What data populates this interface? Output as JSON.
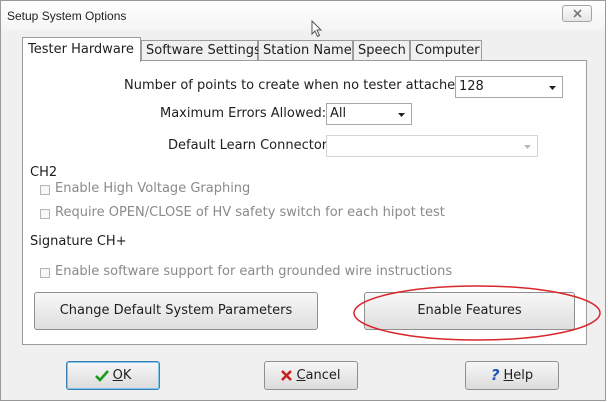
{
  "window": {
    "title": "Setup System Options"
  },
  "tabs": [
    {
      "label": "Tester Hardware",
      "active": true
    },
    {
      "label": "Software Settings",
      "active": false
    },
    {
      "label": "Station Name",
      "active": false
    },
    {
      "label": "Speech",
      "active": false
    },
    {
      "label": "Computer",
      "active": false
    }
  ],
  "tester_hardware": {
    "points_label": "Number of points to create when no tester attached:",
    "points_value": "128",
    "max_errors_label": "Maximum Errors Allowed:",
    "max_errors_value": "All",
    "learn_connector_label": "Default Learn Connector:",
    "learn_connector_value": "",
    "ch2_heading": "CH2",
    "hv_graphing_label": "Enable High Voltage Graphing",
    "hv_switch_label": "Require OPEN/CLOSE of HV safety switch for each hipot test",
    "signature_heading": "Signature CH+",
    "earth_ground_label": "Enable software support for earth grounded wire instructions",
    "change_defaults_button": "Change Default System Parameters",
    "enable_features_button": "Enable Features"
  },
  "footer": {
    "ok": {
      "accel": "O",
      "rest": "K"
    },
    "cancel": {
      "accel": "C",
      "rest": "ancel"
    },
    "help": {
      "accel": "H",
      "rest": "elp"
    }
  },
  "colors": {
    "highlight_ellipse": "#d9262b",
    "ok_check": "#1a9a1a",
    "cancel_x": "#c8201e",
    "help_q": "#1f56b7"
  },
  "icons": [
    "close-icon",
    "mouse-cursor-icon",
    "dropdown-arrow-icon",
    "checkmark-icon",
    "x-mark-icon",
    "question-mark-icon"
  ]
}
